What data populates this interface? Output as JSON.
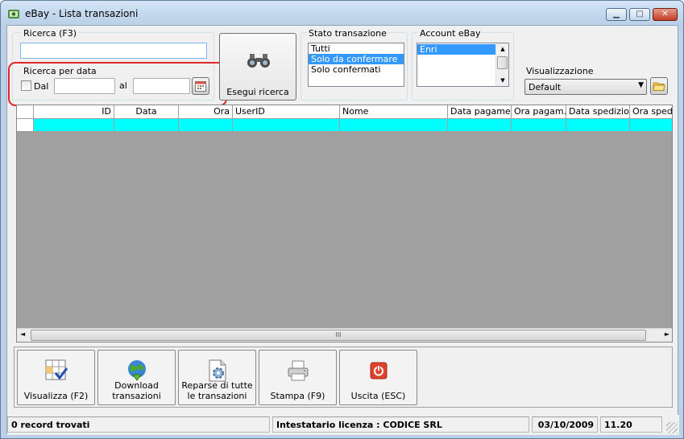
{
  "window": {
    "title": "eBay - Lista transazioni",
    "minimize_label": "▁",
    "maximize_label": "□",
    "close_label": "✕"
  },
  "search": {
    "label": "Ricerca (F3)",
    "value": ""
  },
  "date_search": {
    "label": "Ricerca per data",
    "from_label": "Dal",
    "to_label": "al",
    "from_value": "",
    "to_value": "",
    "from_checked": false
  },
  "run_search": {
    "label": "Esegui ricerca",
    "icon": "binoculars-icon"
  },
  "transaction_status": {
    "label": "Stato transazione",
    "options": [
      "Tutti",
      "Solo da confermare",
      "Solo confermati"
    ],
    "selected": "Solo da confermare"
  },
  "ebay_account": {
    "label": "Account eBay",
    "options": [
      "Enri"
    ],
    "selected": "Enri"
  },
  "view": {
    "label": "Visualizzazione",
    "selected": "Default"
  },
  "grid": {
    "columns": [
      "",
      "ID",
      "Data",
      "Ora",
      "UserID",
      "Nome",
      "Data pagame...",
      "Ora pagam...",
      "Data spedizio...",
      "Ora spediz"
    ],
    "rows": [
      [
        "",
        "",
        "",
        "",
        "",
        "",
        "",
        "",
        "",
        ""
      ]
    ],
    "new_row_color": "#00ffff",
    "scroll_grip": "III"
  },
  "toolbar": {
    "buttons": [
      {
        "label": "Visualizza (F2)",
        "icon": "grid-check-icon"
      },
      {
        "label": "Download transazioni",
        "icon": "globe-download-icon"
      },
      {
        "label": "Reparse di tutte le transazioni",
        "icon": "document-gear-icon"
      },
      {
        "label": "Stampa (F9)",
        "icon": "printer-icon"
      },
      {
        "label": "Uscita (ESC)",
        "icon": "power-icon"
      }
    ]
  },
  "status": {
    "records": "0 record trovati",
    "license": "Intestatario licenza : CODICE SRL",
    "date": "03/10/2009",
    "time": "11.20"
  },
  "colors": {
    "annotation_red": "#e0262a",
    "selection_blue": "#3399ff"
  }
}
